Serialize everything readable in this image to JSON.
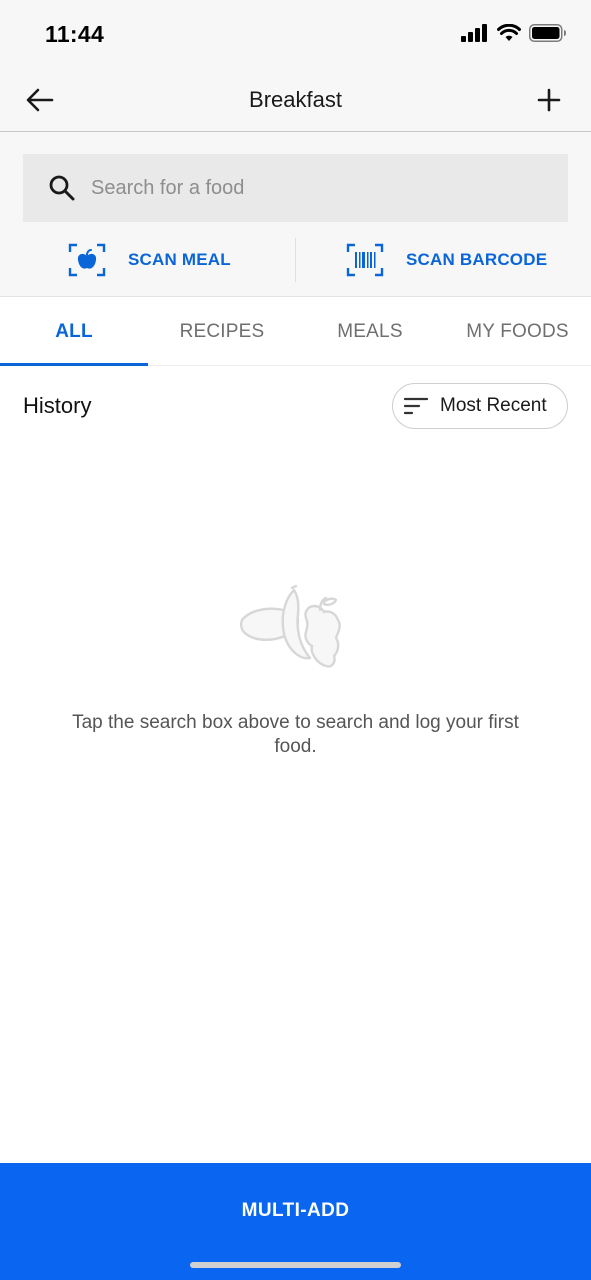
{
  "status_bar": {
    "time": "11:44"
  },
  "header": {
    "title": "Breakfast"
  },
  "search": {
    "placeholder": "Search for a food"
  },
  "scan": {
    "meal_label": "SCAN MEAL",
    "barcode_label": "SCAN BARCODE"
  },
  "tabs": [
    {
      "label": "ALL",
      "active": true
    },
    {
      "label": "RECIPES",
      "active": false
    },
    {
      "label": "MEALS",
      "active": false
    },
    {
      "label": "MY FOODS",
      "active": false
    }
  ],
  "history": {
    "title": "History",
    "sort_label": "Most Recent"
  },
  "empty_state": {
    "message": "Tap the search box above to search and log your first food."
  },
  "footer": {
    "multi_add_label": "MULTI-ADD"
  },
  "colors": {
    "accent": "#0a66d8",
    "button_bg": "#0a66f0",
    "header_bg": "#f7f7f7"
  },
  "icons": [
    "back-arrow-icon",
    "plus-icon",
    "search-icon",
    "scan-meal-icon",
    "barcode-icon",
    "sort-icon",
    "food-illustration-icon",
    "signal-icon",
    "wifi-icon",
    "battery-icon"
  ]
}
